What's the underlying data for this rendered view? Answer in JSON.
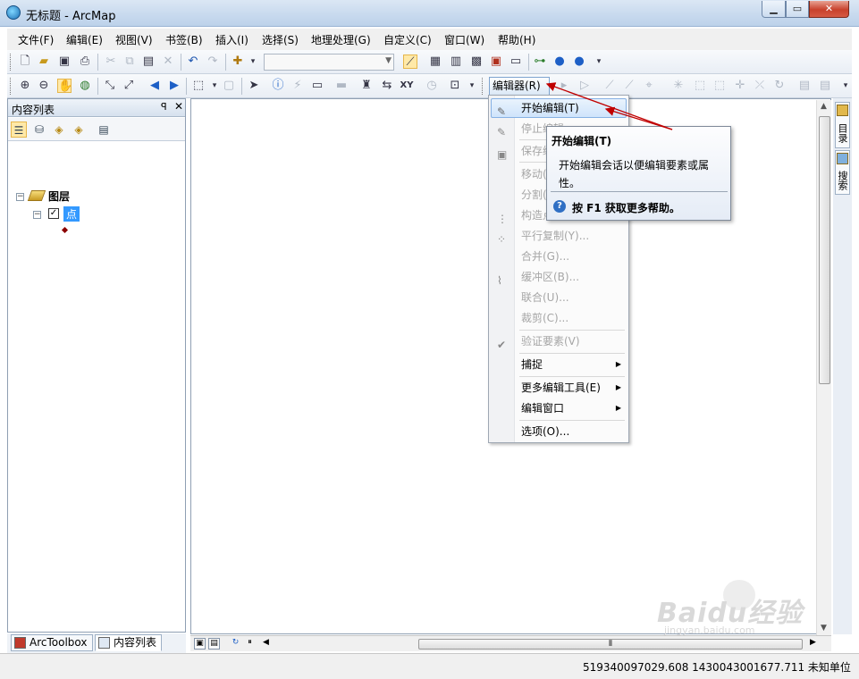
{
  "window": {
    "title": "无标题 - ArcMap",
    "min": "0",
    "max": "1",
    "close": "r"
  },
  "menubar": {
    "items": [
      "文件(F)",
      "编辑(E)",
      "视图(V)",
      "书签(B)",
      "插入(I)",
      "选择(S)",
      "地理处理(G)",
      "自定义(C)",
      "窗口(W)",
      "帮助(H)"
    ]
  },
  "editor_toolbar": {
    "label": "编辑器(R)",
    "dropdown_glyph": "▾"
  },
  "toc": {
    "title": "内容列表",
    "pin": "ꟼ",
    "close": "✕",
    "layers_label": "图层",
    "layer_name": "点",
    "check_mark": "✓",
    "expand_glyph": "−"
  },
  "bottom_tabs": {
    "arctoolbox": "ArcToolbox",
    "toc": "内容列表"
  },
  "right_dock": {
    "catalog": "目录",
    "search": "搜索"
  },
  "editor_menu": {
    "items": [
      {
        "label": "开始编辑(T)",
        "enabled": true
      },
      {
        "label": "停止编辑",
        "enabled": false
      },
      {
        "label": "保存编",
        "enabled": false
      },
      {
        "label": "移动(",
        "enabled": false
      },
      {
        "label": "分割(",
        "enabled": false
      },
      {
        "label": "构造点",
        "enabled": false
      },
      {
        "label": "平行复制(Y)...",
        "enabled": false
      },
      {
        "label": "合并(G)...",
        "enabled": false
      },
      {
        "label": "缓冲区(B)...",
        "enabled": false
      },
      {
        "label": "联合(U)...",
        "enabled": false
      },
      {
        "label": "裁剪(C)...",
        "enabled": false
      },
      {
        "label": "验证要素(V)",
        "enabled": false
      },
      {
        "label": "捕捉",
        "enabled": true,
        "submenu": true
      },
      {
        "label": "更多编辑工具(E)",
        "enabled": true,
        "submenu": true
      },
      {
        "label": "编辑窗口",
        "enabled": true,
        "submenu": true
      },
      {
        "label": "选项(O)...",
        "enabled": true
      }
    ]
  },
  "tooltip": {
    "title": "开始编辑(T)",
    "body": "开始编辑会话以便编辑要素或属性。",
    "help_icon": "?",
    "help": "按 F1 获取更多帮助。"
  },
  "statusbar": {
    "coords": "519340097029.608  1430043001677.711 未知单位"
  },
  "watermark": {
    "logo": "Baidu经验",
    "sub": "jingyan.baidu.com"
  },
  "colors": {
    "accent": "#3399ff",
    "annotation_arrow": "#c00000",
    "menu_highlight": "#cfe4fb"
  }
}
